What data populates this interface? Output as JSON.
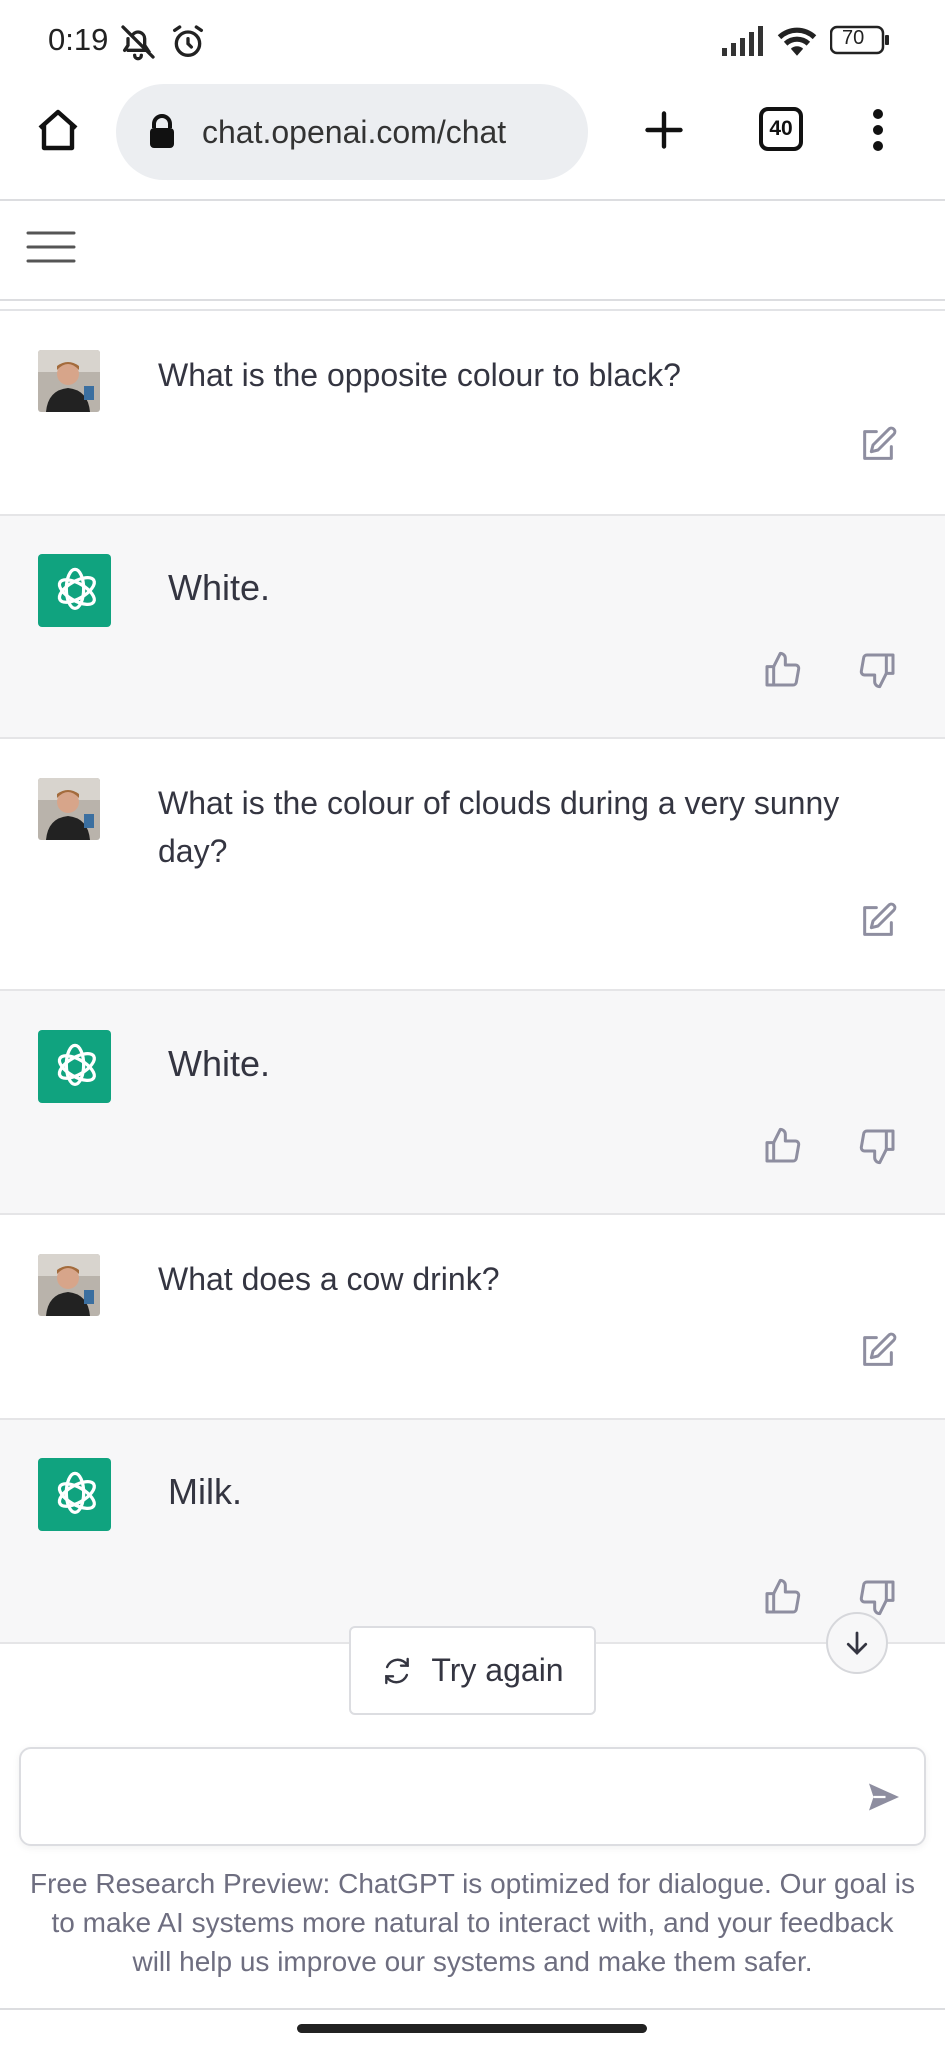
{
  "status_bar": {
    "time": "0:19",
    "battery": "70",
    "icons": [
      "bell-off-icon",
      "alarm-icon",
      "signal-icon",
      "wifi-icon",
      "battery-icon"
    ]
  },
  "browser": {
    "url": "chat.openai.com/chat",
    "tab_count": "40",
    "icons": [
      "home-icon",
      "lock-icon",
      "new-tab-icon",
      "tabs-icon",
      "menu-dots-icon"
    ]
  },
  "app_header": {
    "menu_icon": "hamburger-icon"
  },
  "messages": [
    {
      "role": "user",
      "text": "What is the opposite colour to black?"
    },
    {
      "role": "assistant",
      "text": "White."
    },
    {
      "role": "user",
      "text": "What is the colour of clouds during a very sunny day?"
    },
    {
      "role": "assistant",
      "text": "White."
    },
    {
      "role": "user",
      "text": "What does a cow drink?"
    },
    {
      "role": "assistant",
      "text": "Milk."
    }
  ],
  "composer": {
    "try_again_label": "Try again",
    "input_value": "",
    "disclaimer": "Free Research Preview: ChatGPT is optimized for dialogue. Our goal is to make AI systems more natural to interact with, and your feedback will help us improve our systems and make them safer."
  },
  "colors": {
    "brand_green": "#10a37f",
    "assistant_bg": "#f7f7f8",
    "text": "#343541",
    "muted": "#6e6e80"
  }
}
